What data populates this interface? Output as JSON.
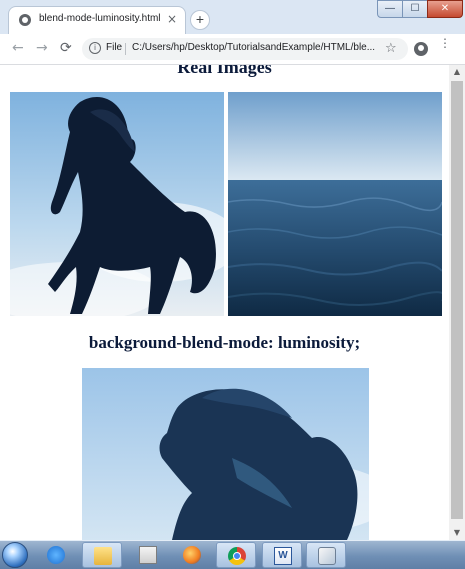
{
  "browser": {
    "tab_title": "blend-mode-luminosity.html",
    "tab_close": "×",
    "new_tab": "+",
    "window_controls": {
      "minimize": "—",
      "maximize": "☐",
      "close": "✕"
    },
    "nav": {
      "back": "←",
      "forward": "→",
      "reload": "⟳"
    },
    "address_scheme": "File",
    "address_url": "C:/Users/hp/Desktop/TutorialsandExample/HTML/ble...",
    "bookmark_star": "☆",
    "menu": "⋮",
    "info_glyph": "i"
  },
  "page": {
    "heading_real": "Real Images",
    "heading_blend": "background-blend-mode: luminosity;",
    "images": [
      {
        "name": "horse-image",
        "depicts": "black horse rearing against sky"
      },
      {
        "name": "sea-image",
        "depicts": "ocean under blue sky"
      },
      {
        "name": "blended-image",
        "depicts": "horse blended with sea image"
      }
    ]
  },
  "scrollbar": {
    "up": "▲",
    "down": "▼",
    "position": 0.0
  },
  "taskbar": {
    "items": [
      {
        "icon": "internet-explorer-icon",
        "active": false
      },
      {
        "icon": "folder-icon",
        "active": true
      },
      {
        "icon": "media-player-icon",
        "active": false
      },
      {
        "icon": "firefox-icon",
        "active": false
      },
      {
        "icon": "chrome-icon",
        "active": true
      },
      {
        "icon": "word-icon",
        "active": true,
        "glyph": "W"
      },
      {
        "icon": "paint-icon",
        "active": true
      }
    ]
  },
  "colors": {
    "heading_text": "#0b1a3a",
    "window_frame": "#dbe6f3",
    "taskbar": "#6f8fb5"
  }
}
